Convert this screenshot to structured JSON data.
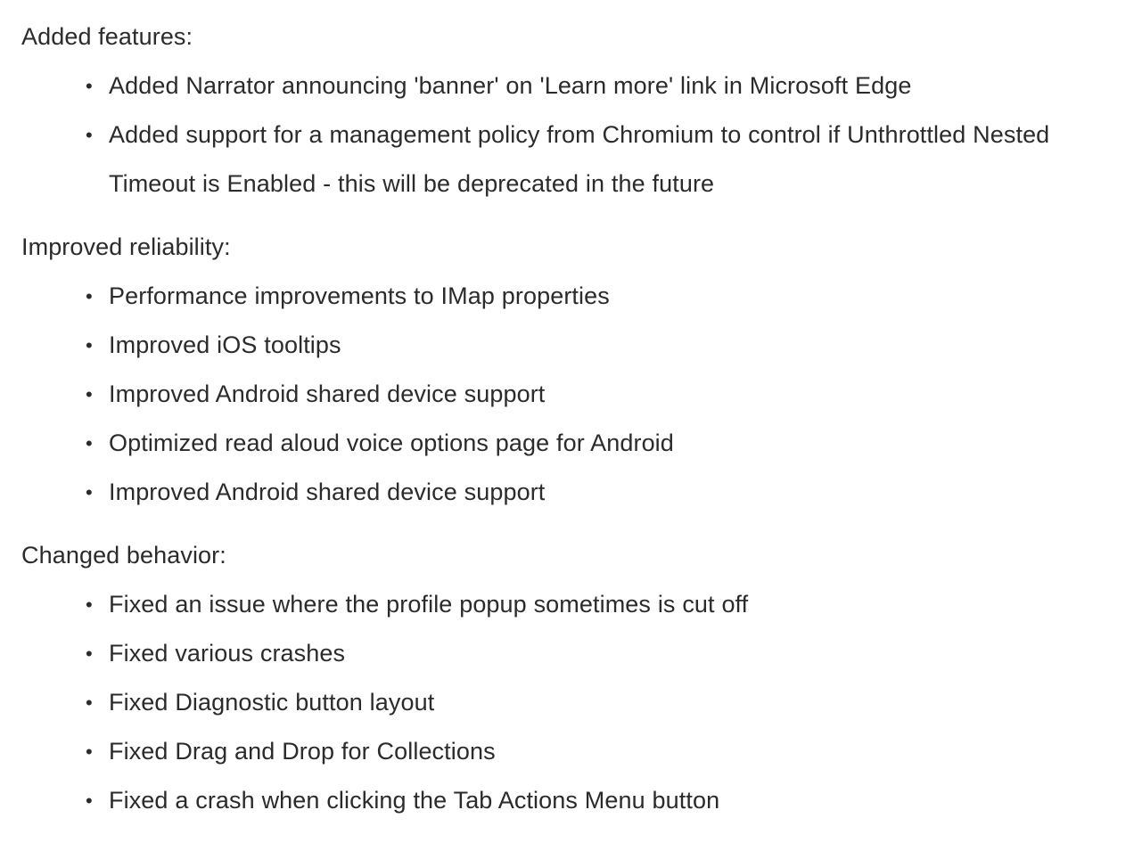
{
  "document": {
    "type": "release-notes",
    "background_color": "#ffffff",
    "text_color": "#2b2b2b",
    "bullet_glyph": "•"
  },
  "sections": [
    {
      "heading": "Added features:",
      "items": [
        "Added Narrator announcing 'banner' on 'Learn more' link in Microsoft Edge",
        "Added support for a management policy from Chromium to control if Unthrottled Nested Timeout is Enabled - this will be deprecated in the future"
      ]
    },
    {
      "heading": "Improved reliability:",
      "items": [
        "Performance improvements to IMap properties",
        "Improved iOS tooltips",
        "Improved Android shared device support",
        "Optimized read aloud voice options page for Android",
        "Improved Android shared device support"
      ]
    },
    {
      "heading": "Changed behavior:",
      "items": [
        "Fixed an issue where the profile popup sometimes is cut off",
        "Fixed various crashes",
        "Fixed Diagnostic button layout",
        "Fixed Drag and Drop for Collections",
        "Fixed a crash when clicking the Tab Actions Menu button"
      ]
    }
  ]
}
